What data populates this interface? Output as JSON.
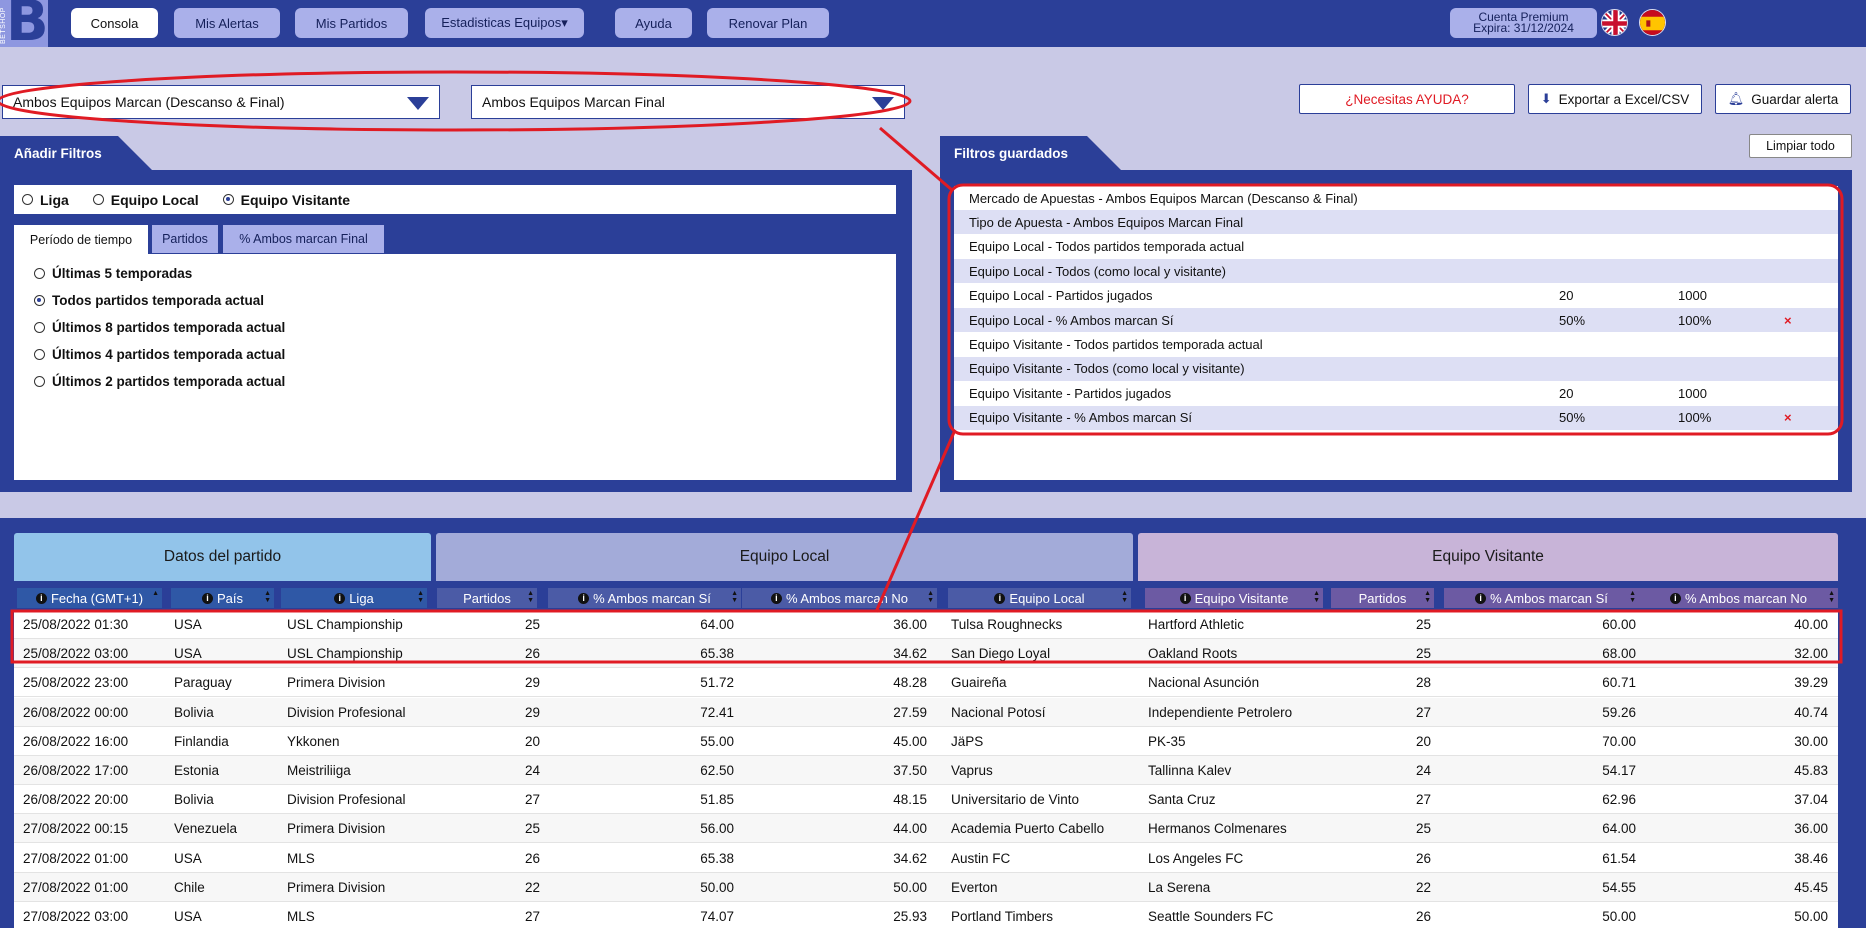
{
  "nav": {
    "logo_letter": "B",
    "logo_text": "BETSHOP",
    "items": [
      "Consola",
      "Mis Alertas",
      "Mis Partidos",
      "Estadisticas Equipos▾",
      "Ayuda",
      "Renovar Plan"
    ],
    "account_line1": "Cuenta Premium",
    "account_line2": "Expira: 31/12/2024"
  },
  "filters": {
    "market_select": "Ambos Equipos Marcan (Descanso & Final)",
    "bet_type_select": "Ambos Equipos Marcan Final",
    "help_button": "¿Necesitas AYUDA?",
    "export_button": "Exportar a Excel/CSV",
    "save_alert_button": "Guardar alerta"
  },
  "add_filters": {
    "title": "Añadir Filtros",
    "radios": [
      "Liga",
      "Equipo Local",
      "Equipo Visitante"
    ],
    "radio_selected": 2,
    "tabs": [
      "Período de tiempo",
      "Partidos",
      "% Ambos marcan Final"
    ],
    "options": [
      "Últimas 5 temporadas",
      "Todos partidos temporada actual",
      "Últimos 8 partidos temporada actual",
      "Últimos 4 partidos temporada actual",
      "Últimos 2 partidos temporada actual"
    ],
    "option_selected": 1
  },
  "saved_filters": {
    "title": "Filtros guardados",
    "clear_button": "Limpiar todo",
    "rows": [
      {
        "label": "Mercado de Apuestas - Ambos Equipos Marcan (Descanso & Final)",
        "v1": "",
        "v2": "",
        "x": ""
      },
      {
        "label": "Tipo de Apuesta - Ambos Equipos Marcan Final",
        "v1": "",
        "v2": "",
        "x": ""
      },
      {
        "label": "Equipo Local - Todos partidos temporada actual",
        "v1": "",
        "v2": "",
        "x": ""
      },
      {
        "label": "Equipo Local - Todos (como local y visitante)",
        "v1": "",
        "v2": "",
        "x": ""
      },
      {
        "label": "Equipo Local - Partidos jugados",
        "v1": "20",
        "v2": "1000",
        "x": ""
      },
      {
        "label": "Equipo Local - % Ambos marcan Sí",
        "v1": "50%",
        "v2": "100%",
        "x": "×"
      },
      {
        "label": "Equipo Visitante - Todos partidos temporada actual",
        "v1": "",
        "v2": "",
        "x": ""
      },
      {
        "label": "Equipo Visitante - Todos (como local y visitante)",
        "v1": "",
        "v2": "",
        "x": ""
      },
      {
        "label": "Equipo Visitante - Partidos jugados",
        "v1": "20",
        "v2": "1000",
        "x": ""
      },
      {
        "label": "Equipo Visitante - % Ambos marcan Sí",
        "v1": "50%",
        "v2": "100%",
        "x": "×"
      }
    ]
  },
  "table": {
    "groups": [
      "Datos del partido",
      "Equipo Local",
      "Equipo Visitante"
    ],
    "columns": [
      "Fecha (GMT+1)",
      "País",
      "Liga",
      "Partidos",
      "% Ambos marcan Sí",
      "% Ambos marcan No",
      "Equipo Local",
      "Equipo Visitante",
      "Partidos",
      "% Ambos marcan Sí",
      "% Ambos marcan No"
    ],
    "rows": [
      [
        "25/08/2022 01:30",
        "USA",
        "USL Championship",
        "25",
        "64.00",
        "36.00",
        "Tulsa Roughnecks",
        "Hartford Athletic",
        "25",
        "60.00",
        "40.00"
      ],
      [
        "25/08/2022 03:00",
        "USA",
        "USL Championship",
        "26",
        "65.38",
        "34.62",
        "San Diego Loyal",
        "Oakland Roots",
        "25",
        "68.00",
        "32.00"
      ],
      [
        "25/08/2022 23:00",
        "Paraguay",
        "Primera Division",
        "29",
        "51.72",
        "48.28",
        "Guaireña",
        "Nacional Asunción",
        "28",
        "60.71",
        "39.29"
      ],
      [
        "26/08/2022 00:00",
        "Bolivia",
        "Division Profesional",
        "29",
        "72.41",
        "27.59",
        "Nacional Potosí",
        "Independiente Petrolero",
        "27",
        "59.26",
        "40.74"
      ],
      [
        "26/08/2022 16:00",
        "Finlandia",
        "Ykkonen",
        "20",
        "55.00",
        "45.00",
        "JäPS",
        "PK-35",
        "20",
        "70.00",
        "30.00"
      ],
      [
        "26/08/2022 17:00",
        "Estonia",
        "Meistriliiga",
        "24",
        "62.50",
        "37.50",
        "Vaprus",
        "Tallinna Kalev",
        "24",
        "54.17",
        "45.83"
      ],
      [
        "26/08/2022 20:00",
        "Bolivia",
        "Division Profesional",
        "27",
        "51.85",
        "48.15",
        "Universitario de Vinto",
        "Santa Cruz",
        "27",
        "62.96",
        "37.04"
      ],
      [
        "27/08/2022 00:15",
        "Venezuela",
        "Primera Division",
        "25",
        "56.00",
        "44.00",
        "Academia Puerto Cabello",
        "Hermanos Colmenares",
        "25",
        "64.00",
        "36.00"
      ],
      [
        "27/08/2022 01:00",
        "USA",
        "MLS",
        "26",
        "65.38",
        "34.62",
        "Austin FC",
        "Los Angeles FC",
        "26",
        "61.54",
        "38.46"
      ],
      [
        "27/08/2022 01:00",
        "Chile",
        "Primera Division",
        "22",
        "50.00",
        "50.00",
        "Everton",
        "La Serena",
        "22",
        "54.55",
        "45.45"
      ],
      [
        "27/08/2022 03:00",
        "USA",
        "MLS",
        "27",
        "74.07",
        "25.93",
        "Portland Timbers",
        "Seattle Sounders FC",
        "26",
        "50.00",
        "50.00"
      ]
    ]
  },
  "colors": {
    "brand": "#2b3f98",
    "nav_button": "#aab0ea",
    "annotation": "#e01b24",
    "group_match": "#92c4ea",
    "group_local": "#a3abd9",
    "group_visitor": "#c8b4d8"
  }
}
